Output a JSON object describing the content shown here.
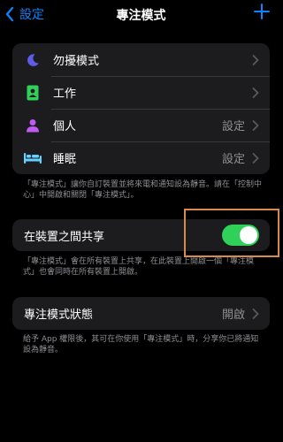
{
  "nav": {
    "back_label": "設定",
    "title": "專注模式"
  },
  "focus_list": [
    {
      "label": "勿擾模式",
      "value": "",
      "icon": "moon-icon",
      "color": "#5e5ce6"
    },
    {
      "label": "工作",
      "value": "",
      "icon": "id-badge-icon",
      "color": "#30d158"
    },
    {
      "label": "個人",
      "value": "設定",
      "icon": "person-icon",
      "color": "#bf5af2"
    },
    {
      "label": "睡眠",
      "value": "設定",
      "icon": "bed-icon",
      "color": "#64d2ff"
    }
  ],
  "focus_list_footnote": "「專注模式」讓你自訂裝置並將來電和通知設為靜音。請在「控制中心」中開啟和關閉「專注模式」。",
  "share": {
    "label": "在裝置之間共享",
    "enabled": true,
    "footnote": "「專注模式」會在所有裝置上共享，在此裝置上開啟一個「專注模式」也會同時在所有裝置上開啟。"
  },
  "status": {
    "label": "專注模式狀態",
    "value": "開啟",
    "footnote": "給予 App 權限後，其可在你使用「專注模式」時，分享你已將通知設為靜音。"
  },
  "colors": {
    "accent": "#0a84ff",
    "switch_on": "#30d158",
    "highlight": "#d98a4e"
  }
}
